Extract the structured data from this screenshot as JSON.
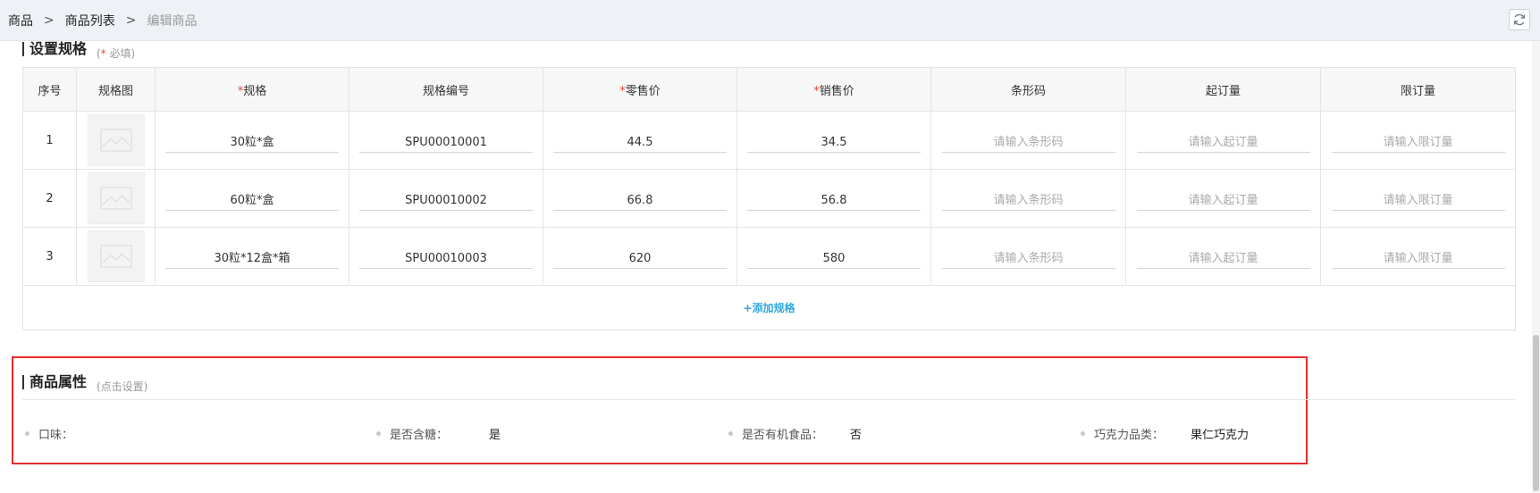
{
  "breadcrumb": {
    "items": [
      "商品",
      "商品列表",
      "编辑商品"
    ]
  },
  "spec_section": {
    "title": "设置规格",
    "subtitle_star": "*",
    "subtitle_text": " 必填"
  },
  "table": {
    "headers": [
      "序号",
      "规格图",
      "规格",
      "规格编号",
      "零售价",
      "销售价",
      "条形码",
      "起订量",
      "限订量"
    ],
    "required_star": "*",
    "rows": [
      {
        "index": "1",
        "spec": "30粒*盒",
        "code": "SPU00010001",
        "retail": "44.5",
        "sale": "34.5"
      },
      {
        "index": "2",
        "spec": "60粒*盒",
        "code": "SPU00010002",
        "retail": "66.8",
        "sale": "56.8"
      },
      {
        "index": "3",
        "spec": "30粒*12盒*箱",
        "code": "SPU00010003",
        "retail": "620",
        "sale": "580"
      }
    ],
    "placeholders": {
      "barcode": "请输入条形码",
      "min_order": "请输入起订量",
      "max_order": "请输入限订量"
    },
    "add_spec_label": "+添加规格"
  },
  "attr_section": {
    "title": "商品属性",
    "subtitle": "(点击设置)",
    "attributes": [
      {
        "label": "口味：",
        "value": ""
      },
      {
        "label": "是否含糖：",
        "value": "是"
      },
      {
        "label": "是否有机食品：",
        "value": "否"
      },
      {
        "label": "巧克力品类：",
        "value": "果仁巧克力"
      }
    ]
  },
  "colors": {
    "accent": "#2fa8e0",
    "required": "#e64545",
    "highlight_box": "#e82c2c"
  },
  "icons": {
    "refresh": "refresh-icon",
    "image_placeholder": "image-placeholder-icon",
    "breadcrumb_separator": "chevron-right-icon"
  }
}
